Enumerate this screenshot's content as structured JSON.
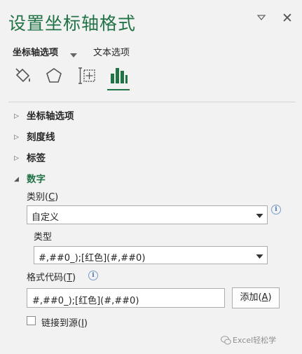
{
  "header": {
    "title": "设置坐标轴格式",
    "pin_icon": "dropdown-arrow-icon",
    "close_icon": "close-icon",
    "close_glyph": "✕"
  },
  "subtabs": {
    "active": "坐标轴选项",
    "other": "文本选项"
  },
  "category_icons": [
    "fill-bucket-icon",
    "pentagon-icon",
    "size-properties-icon",
    "bar-chart-icon"
  ],
  "sections": [
    {
      "label": "坐标轴选项",
      "expanded": false
    },
    {
      "label": "刻度线",
      "expanded": false
    },
    {
      "label": "标签",
      "expanded": false
    },
    {
      "label": "数字",
      "expanded": true
    }
  ],
  "number": {
    "category_label": "类别(",
    "category_key": "C",
    "category_value": "自定义",
    "type_label": "类型",
    "type_value": "#,##0_);[红色](#,##0)",
    "format_code_label": "格式代码(",
    "format_code_key": "T",
    "format_code_value": "#,##0_);[红色](#,##0)",
    "add_button": "添加(",
    "add_key": "A",
    "link_label": "链接到源(",
    "link_key": "I",
    "link_checked": false,
    "close_paren": ")"
  },
  "watermark": "Excel轻松学",
  "colors": {
    "accent": "#217346",
    "background": "#f2f2f2"
  }
}
